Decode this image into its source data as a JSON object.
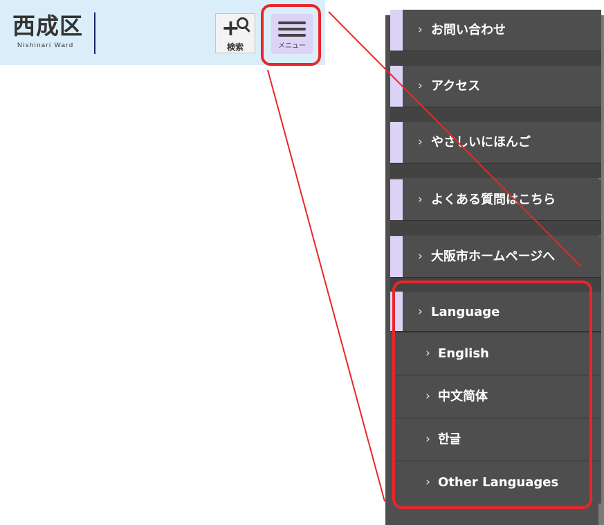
{
  "header": {
    "logo_main": "西成区",
    "logo_sub": "Nishinari Ward",
    "search_label": "検索",
    "menu_label": "メニュー"
  },
  "menu": {
    "items": [
      {
        "label": "お問い合わせ"
      },
      {
        "label": "アクセス"
      },
      {
        "label": "やさしいにほんご"
      },
      {
        "label": "よくある質問はこちら"
      },
      {
        "label": "大阪市ホームページへ"
      },
      {
        "label": "Language"
      }
    ],
    "language_options": [
      {
        "label": "English"
      },
      {
        "label": "中文简体"
      },
      {
        "label": "한글"
      },
      {
        "label": "Other Languages"
      }
    ],
    "chevron": "›"
  },
  "colors": {
    "header_bg": "#daeef9",
    "menu_btn_bg": "#dcd3f6",
    "panel_bg": "#4e4e4e",
    "accent": "#dcd3f6",
    "highlight": "#e8262b"
  }
}
